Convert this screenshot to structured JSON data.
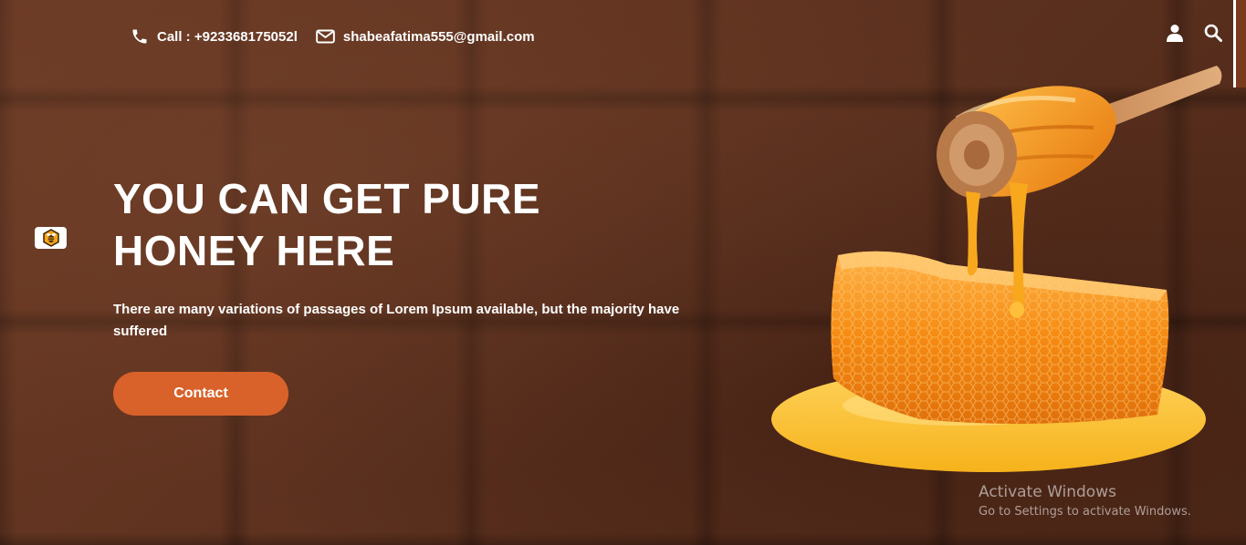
{
  "header": {
    "phone": {
      "icon": "phone-icon",
      "text": "Call : +923368175052l"
    },
    "email": {
      "icon": "envelope-icon",
      "text": "shabeafatima555@gmail.com"
    },
    "actions": [
      {
        "icon": "user-icon"
      },
      {
        "icon": "search-icon"
      }
    ]
  },
  "side_badge": {
    "icon": "bee-logo-icon"
  },
  "hero": {
    "title": "YOU CAN GET PURE HONEY HERE",
    "subtitle": "There are many variations of passages of Lorem Ipsum available, but the majority have suffered",
    "button_label": "Contact"
  },
  "image": {
    "subject": "honey-dipper-honeycomb"
  },
  "watermark": {
    "title": "Activate Windows",
    "subtitle": "Go to Settings to activate Windows."
  },
  "colors": {
    "background": "#5a2f1e",
    "button": "#d9622a",
    "text": "#ffffff"
  }
}
